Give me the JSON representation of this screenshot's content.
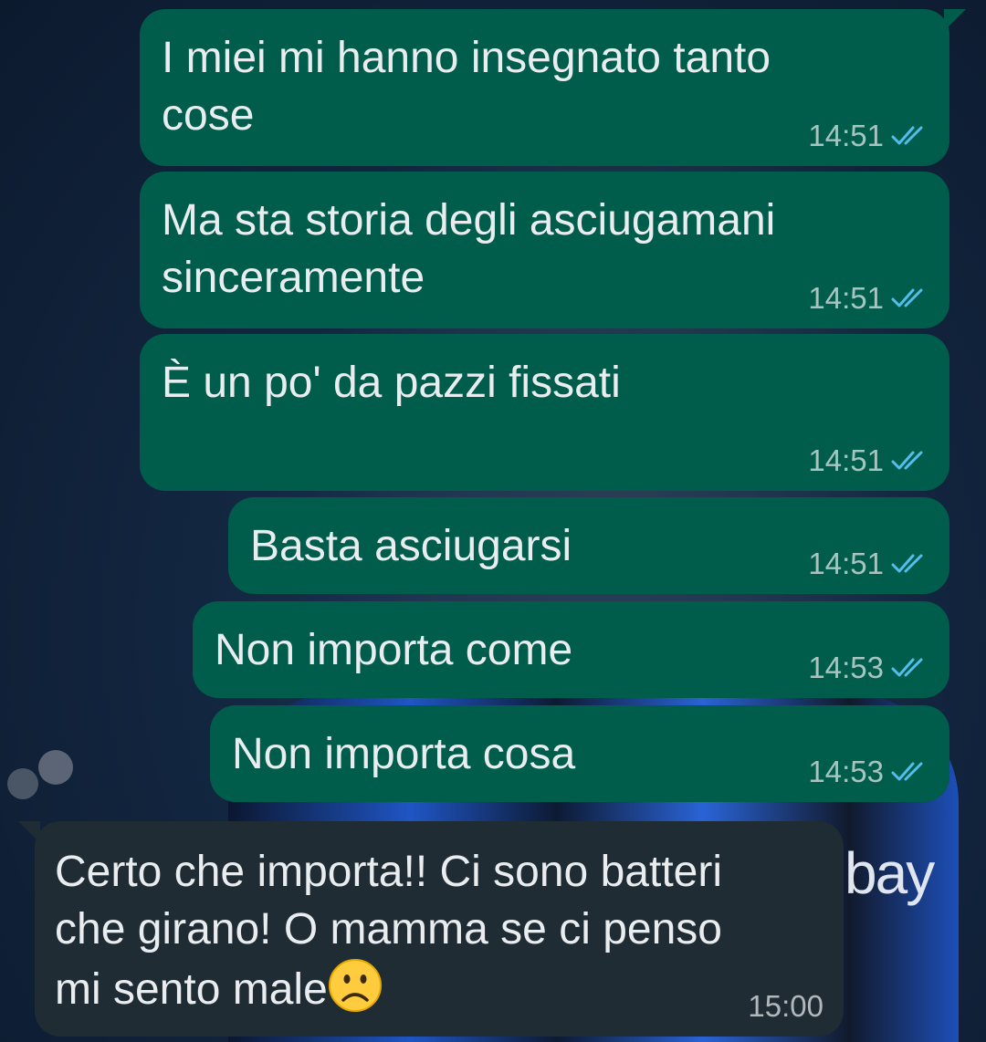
{
  "chat": {
    "messages": [
      {
        "direction": "outgoing",
        "text": "I miei mi hanno insegnato tanto\ncose",
        "time": "14:51",
        "status": "read"
      },
      {
        "direction": "outgoing",
        "text": "Ma sta storia degli asciugamani\nsinceramente",
        "time": "14:51",
        "status": "read"
      },
      {
        "direction": "outgoing",
        "text": "È un po' da pazzi fissati",
        "time": "14:51",
        "status": "read"
      },
      {
        "direction": "outgoing",
        "text": "Basta asciugarsi",
        "time": "14:51",
        "status": "read"
      },
      {
        "direction": "outgoing",
        "text": "Non importa come",
        "time": "14:53",
        "status": "read"
      },
      {
        "direction": "outgoing",
        "text": "Non importa cosa",
        "time": "14:53",
        "status": "read"
      },
      {
        "direction": "incoming",
        "text": "Certo che importa!! Ci sono batteri\nche girano! O mamma se ci penso\nmi sento male",
        "emoji": "frowning-face",
        "time": "15:00"
      }
    ]
  },
  "wallpaper": {
    "logo_text": "bay"
  },
  "colors": {
    "outgoing_bubble": "#005c4b",
    "incoming_bubble": "#202c33",
    "read_ticks": "#53bdeb",
    "text": "#e9edef"
  }
}
